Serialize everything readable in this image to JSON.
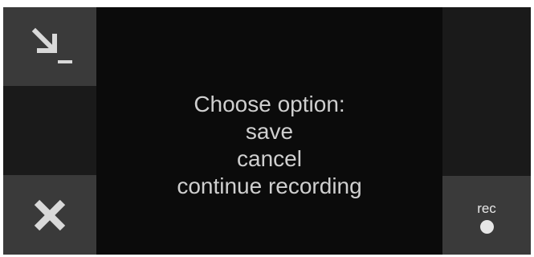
{
  "dialog": {
    "prompt": "Choose option:",
    "options": [
      "save",
      "cancel",
      "continue recording"
    ]
  },
  "buttons": {
    "minimize_icon": "minimize-arrow-icon",
    "close_icon": "close-x-icon",
    "rec_label": "rec",
    "rec_icon": "record-dot-icon"
  },
  "colors": {
    "background": "#0b0b0b",
    "side_panel": "#1a1a1a",
    "button": "#3a3a3a",
    "text": "#cfcfcf"
  }
}
